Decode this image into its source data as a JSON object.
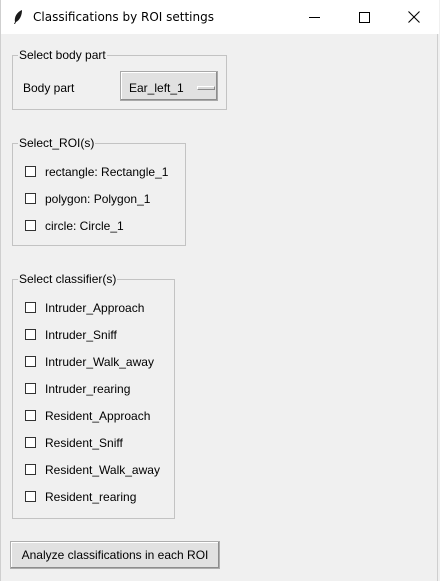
{
  "window": {
    "title": "Classifications by ROI settings",
    "controls": {
      "minimize": "minimize-icon",
      "maximize": "maximize-icon",
      "close": "close-icon"
    }
  },
  "body_part_group": {
    "title": "Select body part",
    "label": "Body part",
    "selected": "Ear_left_1"
  },
  "roi_group": {
    "title": "Select_ROI(s)",
    "items": [
      {
        "label": "rectangle: Rectangle_1",
        "checked": false
      },
      {
        "label": "polygon: Polygon_1",
        "checked": false
      },
      {
        "label": "circle: Circle_1",
        "checked": false
      }
    ]
  },
  "classifier_group": {
    "title": "Select classifier(s)",
    "items": [
      {
        "label": "Intruder_Approach",
        "checked": false
      },
      {
        "label": "Intruder_Sniff",
        "checked": false
      },
      {
        "label": "Intruder_Walk_away",
        "checked": false
      },
      {
        "label": "Intruder_rearing",
        "checked": false
      },
      {
        "label": "Resident_Approach",
        "checked": false
      },
      {
        "label": "Resident_Sniff",
        "checked": false
      },
      {
        "label": "Resident_Walk_away",
        "checked": false
      },
      {
        "label": "Resident_rearing",
        "checked": false
      }
    ]
  },
  "actions": {
    "analyze": "Analyze classifications in each ROI"
  }
}
